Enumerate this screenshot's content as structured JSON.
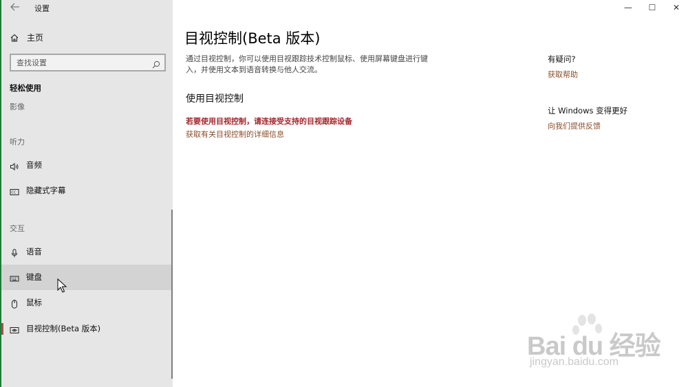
{
  "window": {
    "title": "设置",
    "controls": {
      "minimize": "—",
      "maximize": "☐",
      "close": "✕"
    }
  },
  "sidebar": {
    "home_label": "主页",
    "search_placeholder": "查找设置",
    "category": "轻松使用",
    "groups": {
      "vision": "影像",
      "hearing": "听力",
      "interaction": "交互"
    },
    "items": [
      {
        "label": "音频",
        "icon": "speaker-icon"
      },
      {
        "label": "隐藏式字幕",
        "icon": "closed-caption-icon"
      },
      {
        "label": "语音",
        "icon": "microphone-icon"
      },
      {
        "label": "键盘",
        "icon": "keyboard-icon"
      },
      {
        "label": "鼠标",
        "icon": "mouse-icon"
      },
      {
        "label": "目视控制(Beta 版本)",
        "icon": "eye-control-icon"
      }
    ]
  },
  "main": {
    "title": "目视控制(Beta 版本)",
    "description": "通过目视控制，你可以使用目视跟踪技术控制鼠标、使用屏幕键盘进行键入，并使用文本到语音转换与他人交流。",
    "section_title": "使用目视控制",
    "warning": "若要使用目视控制，请连接受支持的目视跟踪设备",
    "more_info_link": "获取有关目视控制的详细信息"
  },
  "aside": {
    "question_title": "有疑问?",
    "help_link": "获取帮助",
    "improve_title": "让 Windows 变得更好",
    "feedback_link": "向我们提供反馈"
  },
  "watermark": {
    "brand": "Bai du 经验",
    "url": "jingyan.baidu.com"
  },
  "colors": {
    "accent_selected": "#b44a4a",
    "link": "#8a4d2a",
    "warning": "#a4262c",
    "sidebar_bg": "#e6e6e6"
  }
}
